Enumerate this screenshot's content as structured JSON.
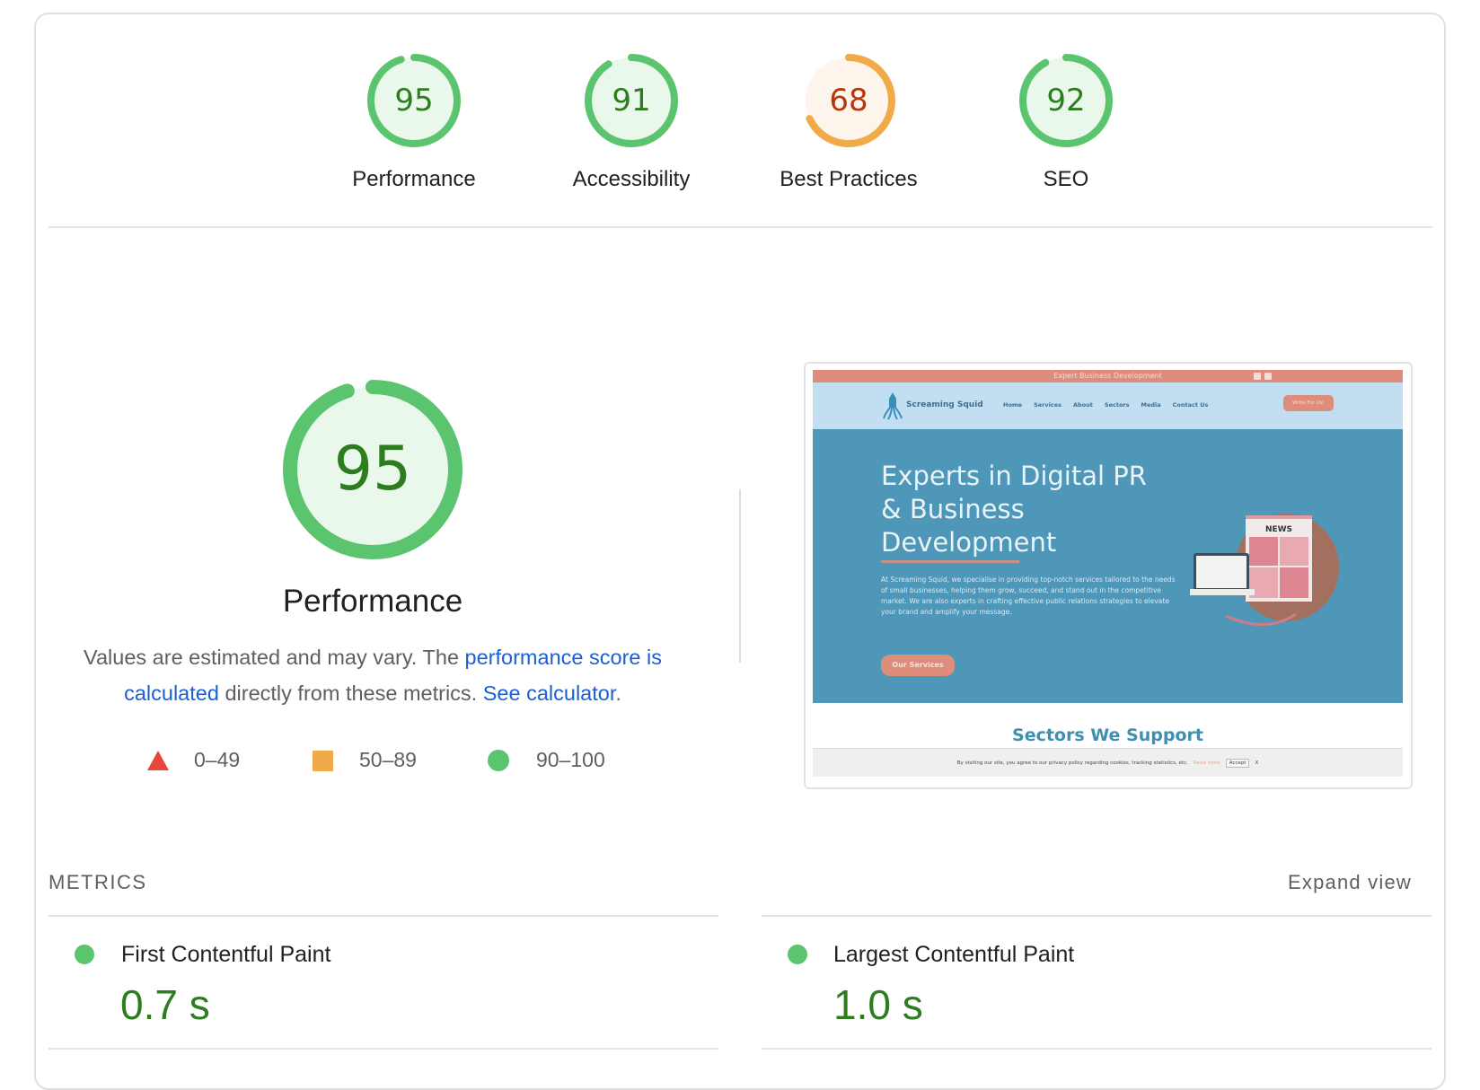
{
  "categories": [
    {
      "label": "Performance",
      "score": 95,
      "rating": "pass"
    },
    {
      "label": "Accessibility",
      "score": 91,
      "rating": "pass"
    },
    {
      "label": "Best Practices",
      "score": 68,
      "rating": "average"
    },
    {
      "label": "SEO",
      "score": 92,
      "rating": "pass"
    }
  ],
  "colors": {
    "pass_ring": "#5ac46e",
    "pass_text": "#2d7d1f",
    "pass_fill": "#eaf8ec",
    "average_ring": "#f0aa48",
    "average_text": "#b3380f",
    "average_fill": "#fdf5eb",
    "fail": "#e8453c",
    "link": "#1a5fd6"
  },
  "performance": {
    "score": 95,
    "title": "Performance",
    "description": {
      "text1": "Values are estimated and may vary. The ",
      "link1": "performance score is calculated",
      "text2": " directly from these metrics. ",
      "link2": "See calculator",
      "text3": "."
    },
    "legend": [
      {
        "icon": "triangle-icon",
        "range": "0–49"
      },
      {
        "icon": "square-icon",
        "range": "50–89"
      },
      {
        "icon": "circle-icon",
        "range": "90–100"
      }
    ]
  },
  "screenshot": {
    "topbar_text": "Expert Business Development",
    "brand": "Screaming Squid",
    "nav": [
      "Home",
      "Services",
      "About",
      "Sectors",
      "Media",
      "Contact Us"
    ],
    "cta": "Write For Us!",
    "hero_title_lines": [
      "Experts in Digital PR",
      "& Business",
      "Development"
    ],
    "hero_body": "At Screaming Squid, we specialise in providing top-notch services tailored to the needs of small businesses, helping them grow, succeed, and stand out in the competitive market. We are also experts in crafting effective public relations strategies to elevate your brand and amplify your message.",
    "hero_button": "Our Services",
    "illustration_text": "NEWS",
    "section_heading": "Sectors We Support",
    "cookie_text": "By visiting our site, you agree to our privacy policy regarding cookies, tracking statistics, etc.",
    "cookie_link": "Read more",
    "cookie_accept": "Accept",
    "cookie_close": "X"
  },
  "metrics": {
    "title": "METRICS",
    "expand_label": "Expand view",
    "items": [
      {
        "name": "First Contentful Paint",
        "value": "0.7 s",
        "rating": "pass"
      },
      {
        "name": "Largest Contentful Paint",
        "value": "1.0 s",
        "rating": "pass"
      }
    ]
  }
}
